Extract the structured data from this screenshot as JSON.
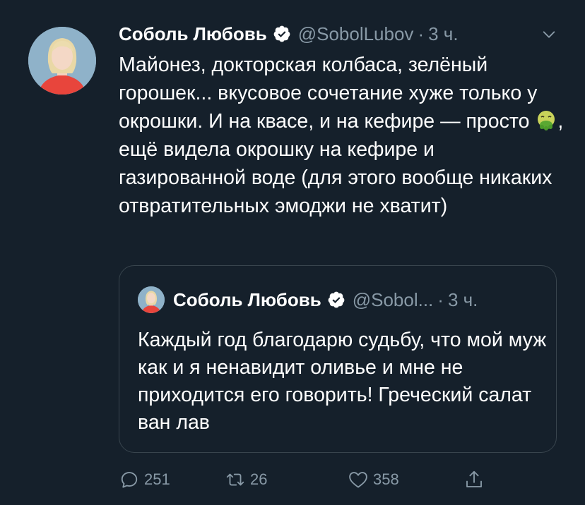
{
  "tweet": {
    "author_name": "Соболь Любовь",
    "handle": "@SobolLubov",
    "separator": "·",
    "time": "3 ч.",
    "text_before_emoji": "Майонез, докторская колбаса, зелёный горошек... вкусовое сочетание хуже только у окрошки. И на квасе, и на кефире — просто ",
    "emoji": "nauseated-face-emoji",
    "text_after_emoji": ", ещё видела окрошку на кефире и газированной воде (для этого вообще никаких отвратительных эмоджи не хватит)"
  },
  "quoted_tweet": {
    "author_name": "Соболь Любовь",
    "handle": "@Sobol...",
    "separator": "·",
    "time": "3 ч.",
    "text": "Каждый год благодарю судьбу, что мой муж как и я ненавидит оливье и мне не приходится его говорить! Греческий салат ван лав"
  },
  "actions": {
    "reply_count": "251",
    "retweet_count": "26",
    "like_count": "358"
  },
  "icons": {
    "verified": "verified-badge-icon",
    "caret": "chevron-down-icon",
    "reply": "reply-icon",
    "retweet": "retweet-icon",
    "like": "heart-icon",
    "share": "share-icon"
  },
  "colors": {
    "background": "#15202b",
    "secondary_text": "#8899a6",
    "border": "#38444d",
    "verified": "#ffffff"
  }
}
